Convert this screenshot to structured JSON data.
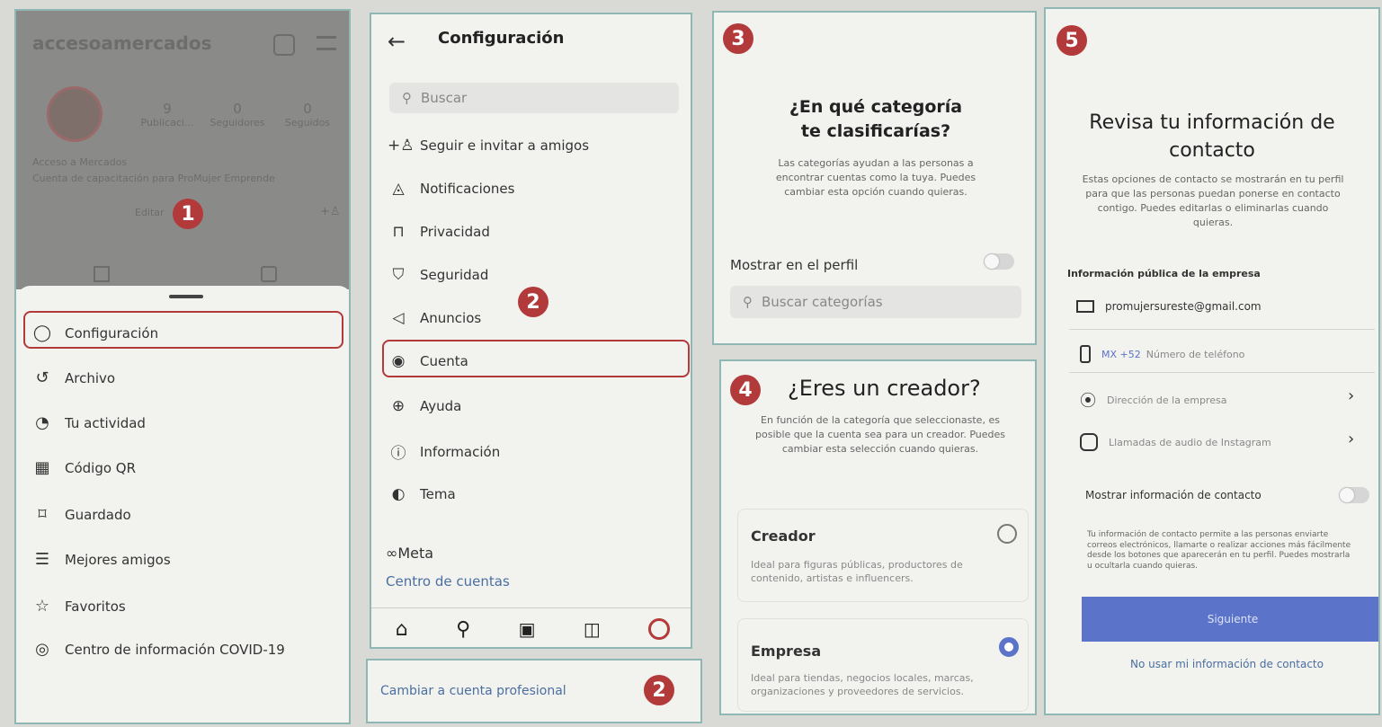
{
  "colors": {
    "badge": "#b23a3a",
    "accent": "#5b74c9",
    "panel_border": "#8fb7b4"
  },
  "badges": [
    "1",
    "2",
    "2",
    "3",
    "4",
    "5"
  ],
  "panel1": {
    "username": "accesoamercados",
    "stats": [
      {
        "num": "9",
        "label": "Publicaci..."
      },
      {
        "num": "0",
        "label": "Seguidores"
      },
      {
        "num": "0",
        "label": "Seguidos"
      }
    ],
    "bio_name": "Acceso a Mercados",
    "bio_text": "Cuenta de capacitación para ProMujer Emprende",
    "edit_label": "Editar",
    "menu": [
      {
        "label": "Configuración",
        "icon": "settings-icon"
      },
      {
        "label": "Archivo",
        "icon": "archive-icon"
      },
      {
        "label": "Tu actividad",
        "icon": "activity-icon"
      },
      {
        "label": "Código QR",
        "icon": "qr-code-icon"
      },
      {
        "label": "Guardado",
        "icon": "bookmark-icon"
      },
      {
        "label": "Mejores amigos",
        "icon": "list-icon"
      },
      {
        "label": "Favoritos",
        "icon": "star-icon"
      },
      {
        "label": "Centro de información COVID-19",
        "icon": "info-center-icon"
      }
    ]
  },
  "panel2": {
    "title": "Configuración",
    "search_placeholder": "Buscar",
    "items": [
      {
        "label": "Seguir e invitar a amigos",
        "icon": "add-person-icon"
      },
      {
        "label": "Notificaciones",
        "icon": "bell-icon"
      },
      {
        "label": "Privacidad",
        "icon": "lock-icon"
      },
      {
        "label": "Seguridad",
        "icon": "shield-icon"
      },
      {
        "label": "Anuncios",
        "icon": "megaphone-icon"
      },
      {
        "label": "Cuenta",
        "icon": "account-icon"
      },
      {
        "label": "Ayuda",
        "icon": "lifebuoy-icon"
      },
      {
        "label": "Información",
        "icon": "info-icon"
      },
      {
        "label": "Tema",
        "icon": "palette-icon"
      }
    ],
    "meta_label": "Meta",
    "accounts_center": "Centro de cuentas",
    "bottom_nav": [
      "home-icon",
      "search-icon",
      "reels-icon",
      "shop-icon",
      "profile-icon"
    ],
    "switch_professional": "Cambiar a cuenta profesional"
  },
  "panel3": {
    "title": "¿En qué categoría te clasificarías?",
    "desc": "Las categorías ayudan a las personas a encontrar cuentas como la tuya. Puedes cambiar esta opción cuando quieras.",
    "show_profile": "Mostrar en el perfil",
    "search_placeholder": "Buscar categorías"
  },
  "panel4": {
    "title": "¿Eres un creador?",
    "desc": "En función de la categoría que seleccionaste, es posible que la cuenta sea para un creador. Puedes cambiar esta selección cuando quieras.",
    "options": [
      {
        "title": "Creador",
        "desc": "Ideal para figuras públicas, productores de contenido, artistas e influencers.",
        "selected": false
      },
      {
        "title": "Empresa",
        "desc": "Ideal para tiendas, negocios locales, marcas, organizaciones y proveedores de servicios.",
        "selected": true
      }
    ]
  },
  "panel5": {
    "title": "Revisa tu información de contacto",
    "desc": "Estas opciones de contacto se mostrarán en tu perfil para que las personas puedan ponerse en contacto contigo. Puedes editarlas o eliminarlas cuando quieras.",
    "section": "Información pública de la empresa",
    "email": "promujersureste@gmail.com",
    "phone_prefix": "MX +52",
    "phone_placeholder": "Número de teléfono",
    "address": "Dirección de la empresa",
    "calls": "Llamadas de audio de Instagram",
    "show_contact": "Mostrar información de contacto",
    "note": "Tu información de contacto permite a las personas enviarte correos electrónicos, llamarte o realizar acciones más fácilmente desde los botones que aparecerán en tu perfil. Puedes mostrarla u ocultarla cuando quieras.",
    "next": "Siguiente",
    "skip": "No usar mi información de contacto"
  }
}
